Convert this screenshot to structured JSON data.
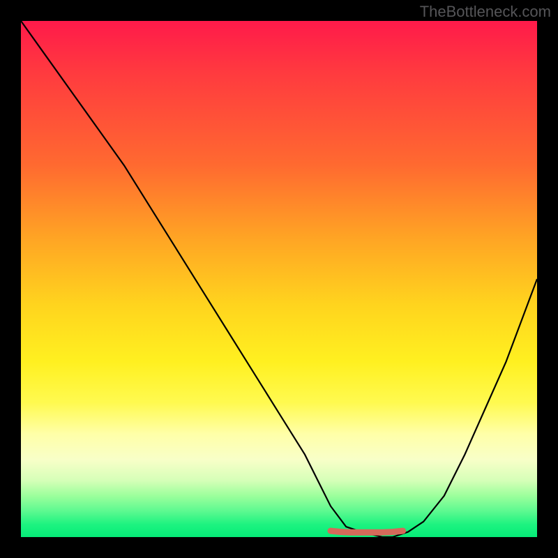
{
  "watermark": "TheBottleneck.com",
  "chart_data": {
    "type": "line",
    "title": "",
    "xlabel": "",
    "ylabel": "",
    "xlim": [
      0,
      100
    ],
    "ylim": [
      0,
      100
    ],
    "series": [
      {
        "name": "bottleneck-curve",
        "x": [
          0,
          5,
          10,
          15,
          20,
          25,
          30,
          35,
          40,
          45,
          50,
          55,
          58,
          60,
          63,
          66,
          70,
          72,
          75,
          78,
          82,
          86,
          90,
          94,
          97,
          100
        ],
        "values": [
          100,
          93,
          86,
          79,
          72,
          64,
          56,
          48,
          40,
          32,
          24,
          16,
          10,
          6,
          2,
          1,
          0,
          0,
          1,
          3,
          8,
          16,
          25,
          34,
          42,
          50
        ]
      },
      {
        "name": "bottom-marker",
        "x": [
          60,
          62,
          64,
          66,
          68,
          70,
          72,
          74
        ],
        "values": [
          1.2,
          1.0,
          0.9,
          0.9,
          0.9,
          0.9,
          1.0,
          1.2
        ]
      }
    ],
    "gradient_stops": [
      {
        "pos": 0,
        "color": "#ff1a4a"
      },
      {
        "pos": 28,
        "color": "#ff6a30"
      },
      {
        "pos": 55,
        "color": "#ffd41e"
      },
      {
        "pos": 80,
        "color": "#ffffa8"
      },
      {
        "pos": 100,
        "color": "#05ec78"
      }
    ],
    "marker_color": "#d46a5a"
  }
}
